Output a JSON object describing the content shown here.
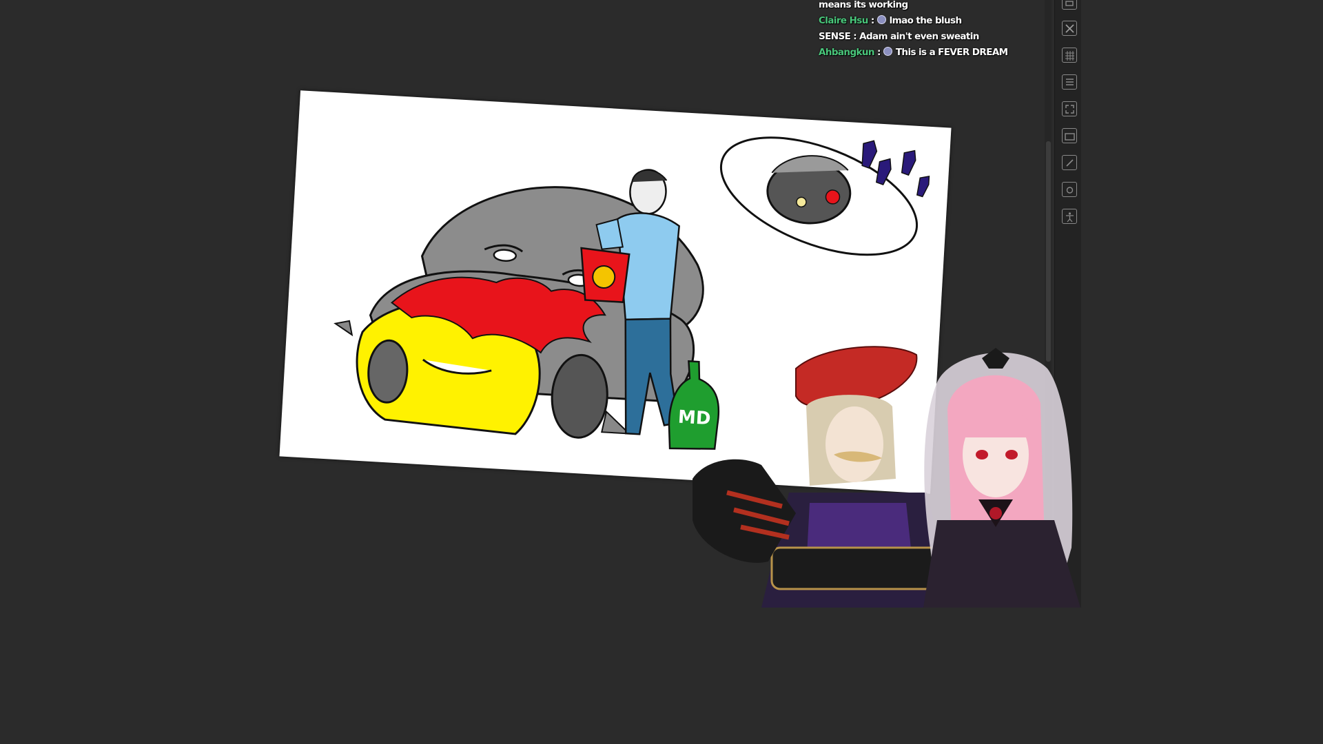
{
  "chat": {
    "messages": [
      {
        "author": "",
        "text": "means its working",
        "emote": false
      },
      {
        "author": "Claire Hsu",
        "text": "lmao the blush",
        "emote": true,
        "author_color": "#49c57a"
      },
      {
        "author": "SENSE",
        "text": "Adam ain't even sweatin",
        "emote": false,
        "author_color": "#ffffff"
      },
      {
        "author": "Ahbangkun",
        "text": "This is a FEVER DREAM",
        "emote": true,
        "author_color": "#49c57a"
      }
    ]
  },
  "canvas": {
    "bottle_label": "MD",
    "colors": {
      "yellow": "#fff200",
      "red": "#e8141b",
      "shirt": "#8ecbef",
      "jeans": "#2d6f9a",
      "bottle": "#1f9e2f",
      "grey": "#8c8c8c"
    }
  },
  "toolstrip": {
    "icons": [
      "layers-icon",
      "close-box-icon",
      "grid-icon",
      "list-icon",
      "expand-icon",
      "folder-icon",
      "edit-icon",
      "camera-icon",
      "accessibility-icon"
    ]
  },
  "colors": {
    "background": "#2b2b2b",
    "panel": "#232323",
    "chat_author": "#49c57a"
  }
}
